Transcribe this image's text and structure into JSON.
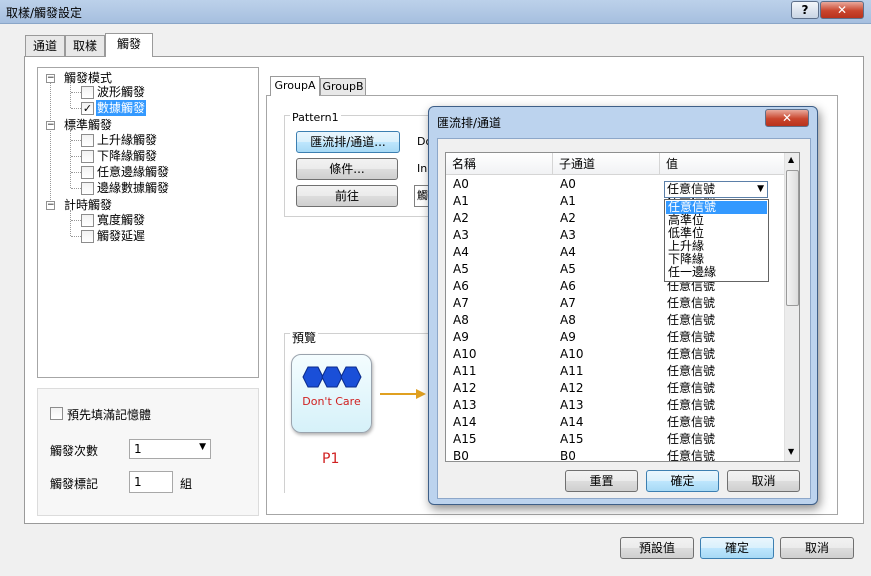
{
  "window": {
    "title": "取樣/觸發設定",
    "help": "?",
    "close": "✕"
  },
  "tabs": [
    "通道",
    "取樣",
    "觸發"
  ],
  "tree": {
    "items": [
      {
        "label": "觸發模式",
        "level": 0,
        "checkbox": false
      },
      {
        "label": "波形觸發",
        "level": 1,
        "checkbox": true,
        "checked": false
      },
      {
        "label": "數據觸發",
        "level": 1,
        "checkbox": true,
        "checked": true,
        "selected": true
      },
      {
        "label": "標準觸發",
        "level": 0,
        "checkbox": false
      },
      {
        "label": "上升緣觸發",
        "level": 1,
        "checkbox": true,
        "checked": false
      },
      {
        "label": "下降緣觸發",
        "level": 1,
        "checkbox": true,
        "checked": false
      },
      {
        "label": "任意邊緣觸發",
        "level": 1,
        "checkbox": true,
        "checked": false
      },
      {
        "label": "邊緣數據觸發",
        "level": 1,
        "checkbox": true,
        "checked": false
      },
      {
        "label": "計時觸發",
        "level": 0,
        "checkbox": false
      },
      {
        "label": "寬度觸發",
        "level": 1,
        "checkbox": true,
        "checked": false
      },
      {
        "label": "觸發延遲",
        "level": 1,
        "checkbox": true,
        "checked": false
      }
    ]
  },
  "options": {
    "prefill_label": "預先填滿記憶體",
    "count_label": "觸發次數",
    "count_value": "1",
    "mark_label": "觸發標記",
    "mark_value": "1",
    "mark_unit": "組"
  },
  "group_tabs": [
    "GroupA",
    "GroupB"
  ],
  "pattern": {
    "title": "Pattern1",
    "bus_button": "匯流排/通道...",
    "cond_button": "條件...",
    "prev_button": "前往",
    "field1": "Do",
    "field2": "In",
    "field3": "觸"
  },
  "preview": {
    "label": "預覽",
    "block_text": "Don't Care",
    "block_name": "P1"
  },
  "dialog": {
    "title": "匯流排/通道",
    "close": "✕",
    "columns": [
      "名稱",
      "子通道",
      "值"
    ],
    "rows": [
      [
        "A0",
        "A0",
        "任意信號"
      ],
      [
        "A1",
        "A1",
        "任意信號"
      ],
      [
        "A2",
        "A2",
        "任意信號"
      ],
      [
        "A3",
        "A3",
        "任意信號"
      ],
      [
        "A4",
        "A4",
        "任意信號"
      ],
      [
        "A5",
        "A5",
        "任意信號"
      ],
      [
        "A6",
        "A6",
        "任意信號"
      ],
      [
        "A7",
        "A7",
        "任意信號"
      ],
      [
        "A8",
        "A8",
        "任意信號"
      ],
      [
        "A9",
        "A9",
        "任意信號"
      ],
      [
        "A10",
        "A10",
        "任意信號"
      ],
      [
        "A11",
        "A11",
        "任意信號"
      ],
      [
        "A12",
        "A12",
        "任意信號"
      ],
      [
        "A13",
        "A13",
        "任意信號"
      ],
      [
        "A14",
        "A14",
        "任意信號"
      ],
      [
        "A15",
        "A15",
        "任意信號"
      ],
      [
        "B0",
        "B0",
        "任意信號"
      ]
    ],
    "dropdown_value": "任意信號",
    "dropdown_options": [
      "任意信號",
      "高準位",
      "低準位",
      "上升緣",
      "下降緣",
      "任一邊緣"
    ],
    "reset_button": "重置",
    "ok_button": "確定",
    "cancel_button": "取消"
  },
  "footer": {
    "default_button": "預設值",
    "ok_button": "確定",
    "cancel_button": "取消"
  },
  "colors": {
    "selection": "#3399ff",
    "hex_blue": "#1a4fd8",
    "arrow": "#e0a020",
    "p1_red": "#d02020"
  }
}
